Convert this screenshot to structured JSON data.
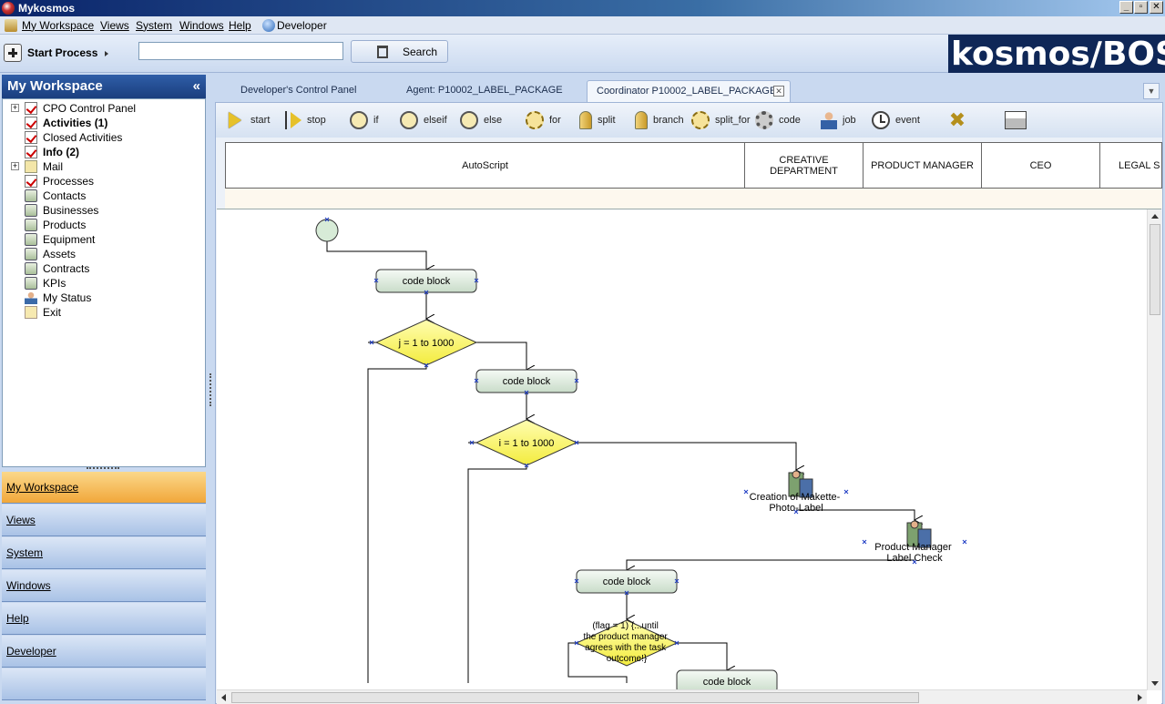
{
  "window": {
    "title": "Mykosmos",
    "brand": "kosmos/BOS"
  },
  "menu": {
    "items": [
      "My Workspace",
      "Views",
      "System",
      "Windows",
      "Help",
      "Developer"
    ]
  },
  "toolbar": {
    "start_process_label": "Start Process",
    "search_value": "",
    "search_label": "Search"
  },
  "workspace": {
    "title": "My Workspace",
    "collapse_glyph": "«",
    "tree": [
      {
        "label": "CPO Control Panel",
        "bold": false,
        "icon": "checklist-icon",
        "expand": true
      },
      {
        "label": "Activities (1)",
        "bold": true,
        "icon": "checklist-icon",
        "expand": false
      },
      {
        "label": "Closed Activities",
        "bold": false,
        "icon": "checklist-icon",
        "expand": false
      },
      {
        "label": "Info (2)",
        "bold": true,
        "icon": "checklist-icon",
        "expand": false
      },
      {
        "label": "Mail",
        "bold": false,
        "icon": "mail-icon",
        "expand": true
      },
      {
        "label": "Processes",
        "bold": false,
        "icon": "checklist-icon",
        "expand": false
      },
      {
        "label": "Contacts",
        "bold": false,
        "icon": "card-icon",
        "expand": false
      },
      {
        "label": "Businesses",
        "bold": false,
        "icon": "card-icon",
        "expand": false
      },
      {
        "label": "Products",
        "bold": false,
        "icon": "card-icon",
        "expand": false
      },
      {
        "label": "Equipment",
        "bold": false,
        "icon": "card-icon",
        "expand": false
      },
      {
        "label": "Assets",
        "bold": false,
        "icon": "card-icon",
        "expand": false
      },
      {
        "label": "Contracts",
        "bold": false,
        "icon": "card-icon",
        "expand": false
      },
      {
        "label": "KPIs",
        "bold": false,
        "icon": "card-icon",
        "expand": false
      },
      {
        "label": "My Status",
        "bold": false,
        "icon": "person-icon",
        "expand": false
      },
      {
        "label": "Exit",
        "bold": false,
        "icon": "exit-icon",
        "expand": false
      }
    ],
    "nav": [
      {
        "label": "My Workspace",
        "active": true
      },
      {
        "label": "Views",
        "active": false
      },
      {
        "label": "System",
        "active": false
      },
      {
        "label": "Windows",
        "active": false
      },
      {
        "label": "Help",
        "active": false
      },
      {
        "label": "Developer",
        "active": false
      }
    ]
  },
  "tabs": [
    {
      "label": "Developer's Control Panel",
      "active": false
    },
    {
      "label": "Agent: P10002_LABEL_PACKAGE",
      "active": false
    },
    {
      "label": "Coordinator P10002_LABEL_PACKAGE",
      "active": true
    }
  ],
  "designer_tools": [
    {
      "label": "start",
      "icon": "play-icon"
    },
    {
      "label": "stop",
      "icon": "stop-icon"
    },
    {
      "label": "if",
      "icon": "if-icon"
    },
    {
      "label": "elseif",
      "icon": "elseif-icon"
    },
    {
      "label": "else",
      "icon": "else-icon"
    },
    {
      "label": "for",
      "icon": "for-icon"
    },
    {
      "label": "split",
      "icon": "split-icon"
    },
    {
      "label": "branch",
      "icon": "branch-icon"
    },
    {
      "label": "split_for",
      "icon": "split-for-icon"
    },
    {
      "label": "code",
      "icon": "gear-icon"
    },
    {
      "label": "job",
      "icon": "job-icon"
    },
    {
      "label": "event",
      "icon": "clock-icon"
    }
  ],
  "lanes": [
    "AutoScript",
    "CREATIVE DEPARTMENT",
    "PRODUCT MANAGER",
    "CEO",
    "LEGAL S"
  ],
  "diagram": {
    "code_block_label": "code block",
    "loop_j": "j = 1 to 1000",
    "loop_i": "i = 1 to 1000",
    "job1": [
      "Creation of Makette-",
      "Photo-Label"
    ],
    "job2": [
      "Product Manager",
      "Label Check"
    ],
    "until_condition": [
      "(flag = 1)   {...until",
      "the product manager",
      "agrees with the task",
      "outcome!}"
    ]
  },
  "colors": {
    "decision_fill": "#fbf77a",
    "code_fill": "#e3efe3",
    "active_nav": "#f1a73a",
    "title_bar": "#0a246a"
  }
}
